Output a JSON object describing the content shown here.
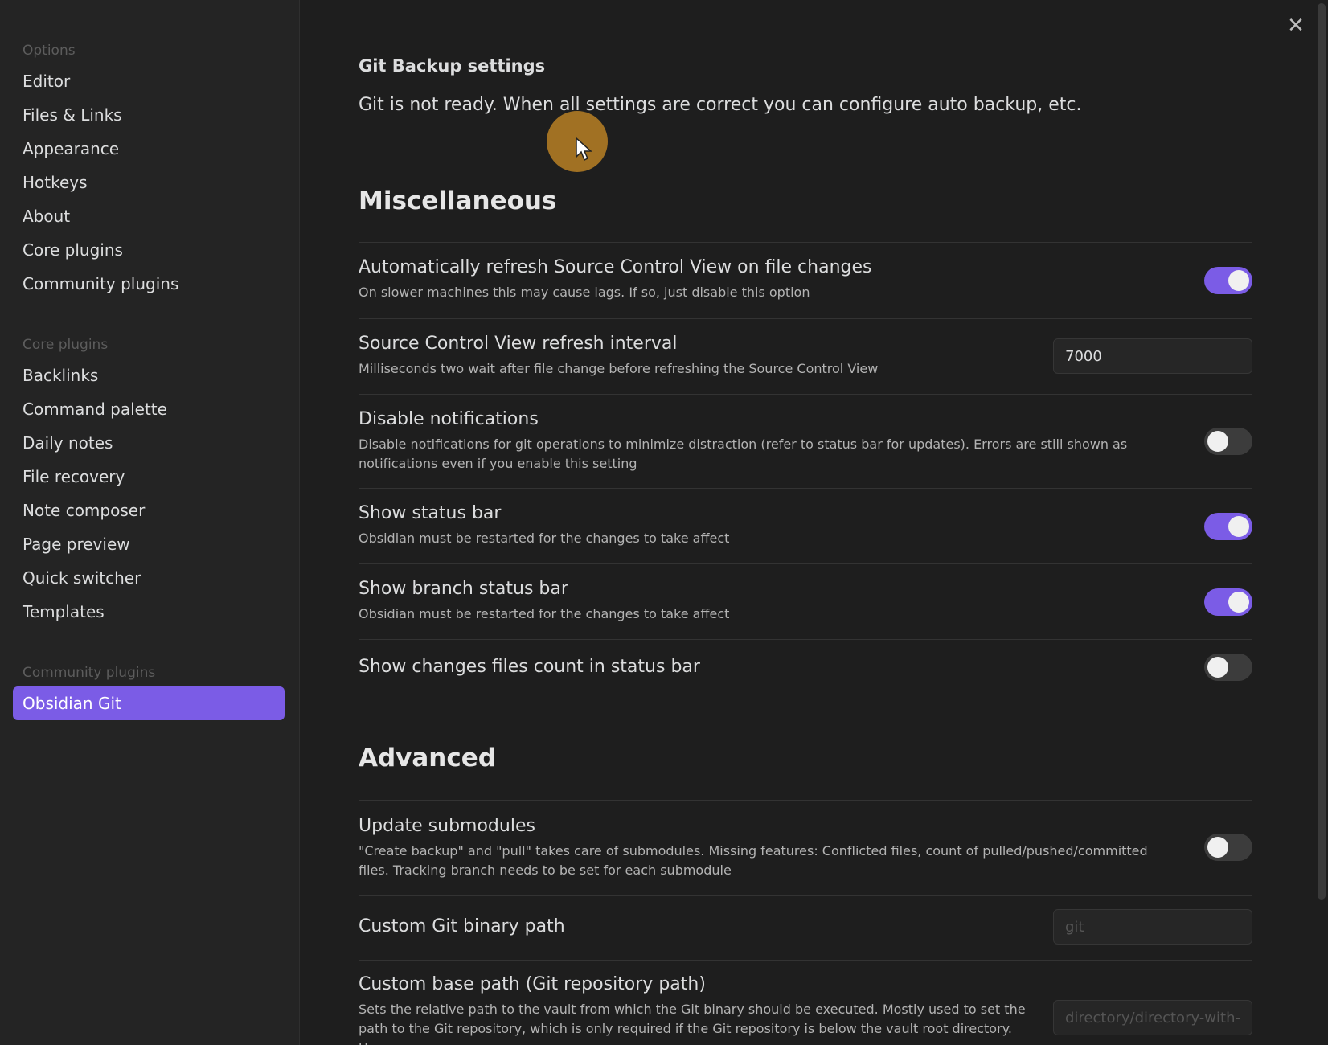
{
  "sidebar": {
    "groups": [
      {
        "title": "Options",
        "items": [
          "Editor",
          "Files & Links",
          "Appearance",
          "Hotkeys",
          "About",
          "Core plugins",
          "Community plugins"
        ]
      },
      {
        "title": "Core plugins",
        "items": [
          "Backlinks",
          "Command palette",
          "Daily notes",
          "File recovery",
          "Note composer",
          "Page preview",
          "Quick switcher",
          "Templates"
        ]
      },
      {
        "title": "Community plugins",
        "items": [
          "Obsidian Git"
        ]
      }
    ],
    "active_item": "Obsidian Git"
  },
  "close_icon": "close-icon",
  "content": {
    "title": "Git Backup settings",
    "note": "Git is not ready. When all settings are correct you can configure auto backup, etc.",
    "sections": {
      "misc": {
        "heading": "Miscellaneous",
        "settings": [
          {
            "name": "Automatically refresh Source Control View on file changes",
            "desc": "On slower machines this may cause lags. If so, just disable this option",
            "control": "toggle",
            "value": true
          },
          {
            "name": "Source Control View refresh interval",
            "desc": "Milliseconds two wait after file change before refreshing the Source Control View",
            "control": "text",
            "value": "7000"
          },
          {
            "name": "Disable notifications",
            "desc": "Disable notifications for git operations to minimize distraction (refer to status bar for updates). Errors are still shown as notifications even if you enable this setting",
            "control": "toggle",
            "value": false
          },
          {
            "name": "Show status bar",
            "desc": "Obsidian must be restarted for the changes to take affect",
            "control": "toggle",
            "value": true
          },
          {
            "name": "Show branch status bar",
            "desc": "Obsidian must be restarted for the changes to take affect",
            "control": "toggle",
            "value": true
          },
          {
            "name": "Show changes files count in status bar",
            "desc": "",
            "control": "toggle",
            "value": false
          }
        ]
      },
      "advanced": {
        "heading": "Advanced",
        "settings": [
          {
            "name": "Update submodules",
            "desc": "\"Create backup\" and \"pull\" takes care of submodules. Missing features: Conflicted files, count of pulled/pushed/committed files. Tracking branch needs to be set for each submodule",
            "control": "toggle",
            "value": false
          },
          {
            "name": "Custom Git binary path",
            "desc": "",
            "control": "text",
            "value": "",
            "placeholder": "git"
          },
          {
            "name": "Custom base path (Git repository path)",
            "desc": "Sets the relative path to the vault from which the Git binary should be executed. Mostly used to set the path to the Git repository, which is only required if the Git repository is below the vault root directory. Use",
            "control": "text",
            "value": "",
            "placeholder": "directory/directory-with-git"
          }
        ]
      }
    }
  },
  "colors": {
    "accent": "#7b5ce6",
    "background": "#1e1e1e",
    "sidebar": "#242424"
  }
}
